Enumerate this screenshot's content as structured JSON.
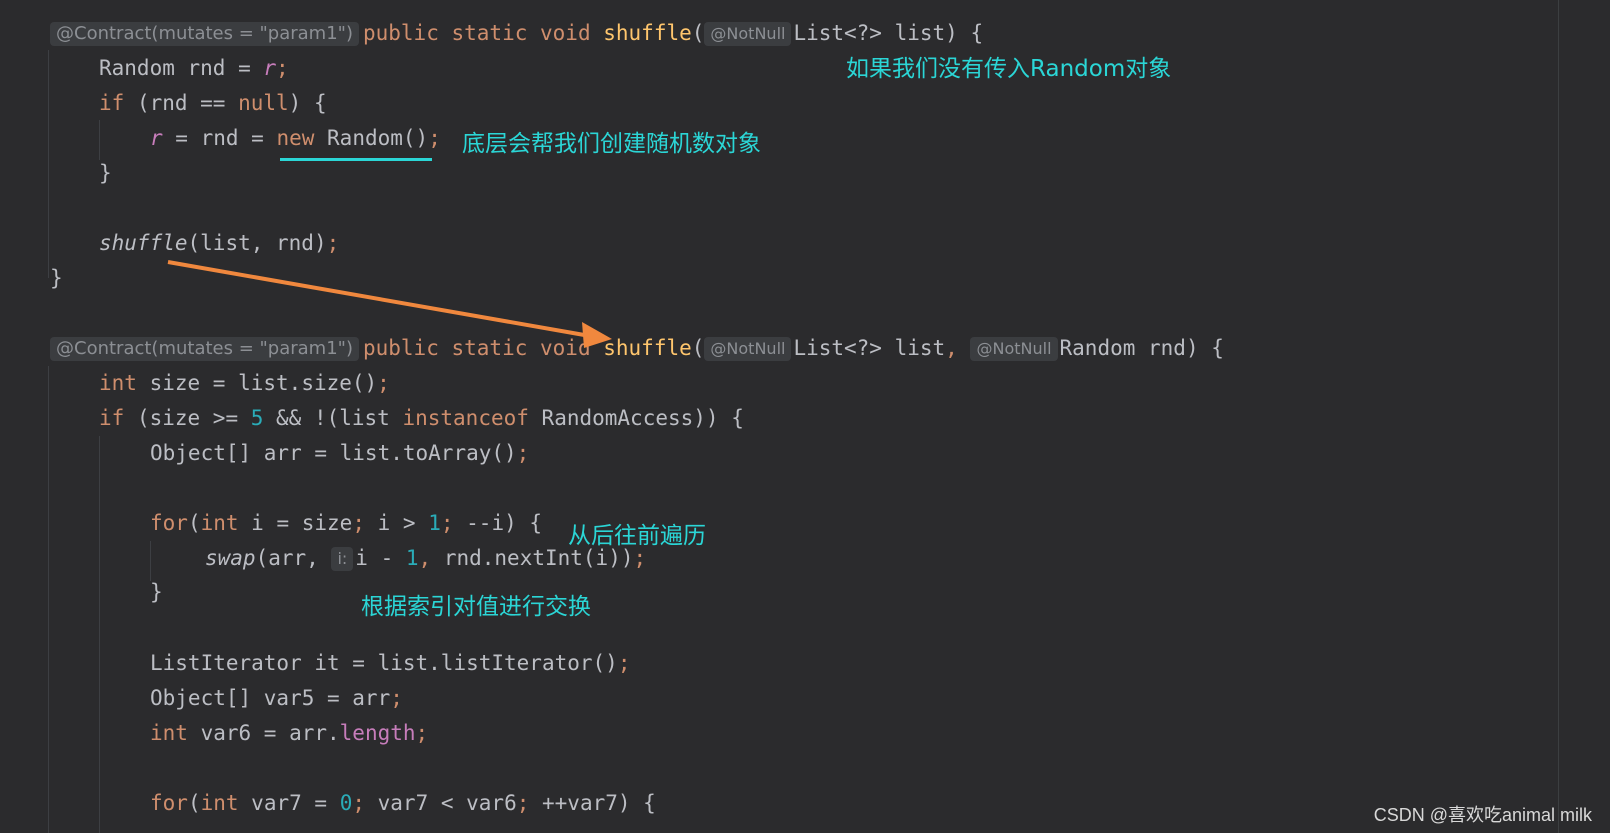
{
  "code": {
    "contract_hint": "@Contract(mutates = \"param1\")",
    "notnull_hint": "@NotNull",
    "index_hint": "i:",
    "kw_public": "public",
    "kw_static": "static",
    "kw_void": "void",
    "kw_if": "if",
    "kw_new": "new",
    "kw_null": "null",
    "kw_int": "int",
    "kw_for": "for",
    "kw_instanceof": "instanceof",
    "shuffle": "shuffle",
    "open_paren": "(",
    "list_type_param": "List<?> list) {",
    "list_type_param2": "List<?> list",
    "comma": ",",
    "random_rnd_param": "Random rnd) {",
    "l2_a": "Random rnd = ",
    "l2_r": "r",
    "semi": ";",
    "l3_a": " (rnd == ",
    "l3_b": ") {",
    "l4_a": " = rnd = ",
    "l4_b": " Random()",
    "close_brace": "}",
    "l7_b": "(list, rnd)",
    "m2_a": " size = list.",
    "m2_b": "size()",
    "m3_a": " (size >= ",
    "m3_num": "5",
    "m3_b": " && !(list ",
    "m3_c": " RandomAccess)) {",
    "m4_a": "Object[] arr = list.",
    "m4_b": "toArray()",
    "m6_a": "(",
    "m6_b": " i = size",
    "m6_c": " i > ",
    "m6_num": "1",
    "m6_d": " --i) {",
    "m7_fn": "swap",
    "m7_a": "(arr,",
    "m7_b": "i - ",
    "m7_num": "1",
    "m7_c": " rnd.",
    "m7_d": "nextInt(i))",
    "m10_a": "ListIterator it = list.",
    "m10_b": "listIterator()",
    "m11_a": "Object[] var5 = arr",
    "m12_a": " var6 = arr.",
    "m12_field": "length",
    "m14_a": "(",
    "m14_b": " var7 = ",
    "m14_num": "0",
    "m14_c": " var7 < var6",
    "m14_d": " ++var7) {"
  },
  "notes": {
    "no_random": "如果我们没有传入Random对象",
    "create_random": "底层会帮我们创建随机数对象",
    "reverse_iter": "从后往前遍历",
    "swap_values": "根据索引对值进行交换"
  },
  "watermark": "CSDN @喜欢吃animal milk",
  "colors": {
    "background": "#2b2b2d",
    "annotation": "#2bd6d6",
    "arrow": "#f0883e",
    "keyword": "#cf8e6d",
    "function_decl": "#ffc66d"
  }
}
